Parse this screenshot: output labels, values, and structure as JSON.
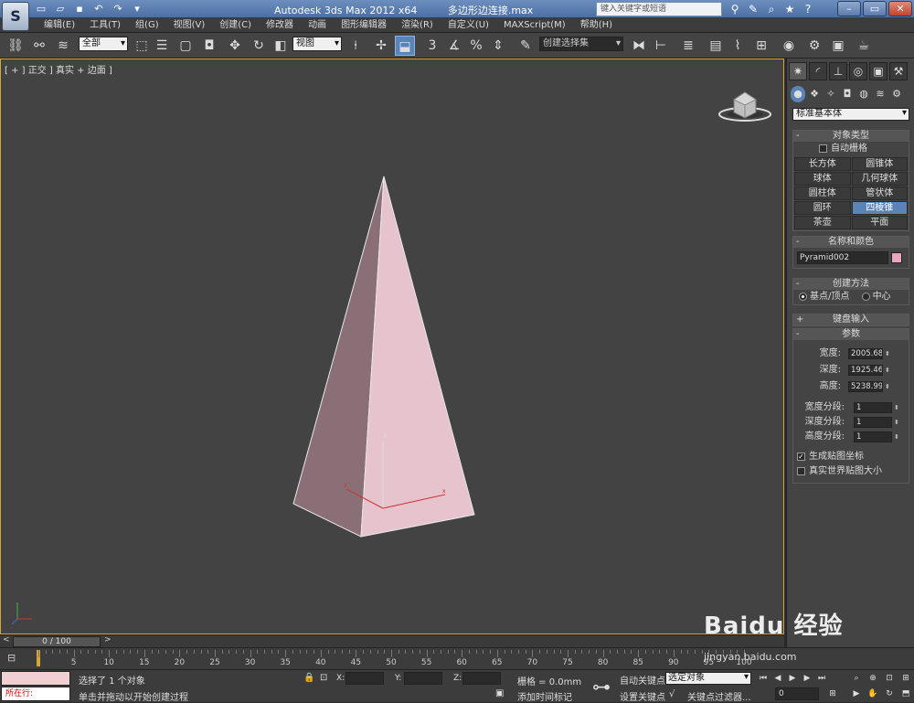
{
  "app": {
    "title": "Autodesk 3ds Max  2012 x64",
    "filename": "多边形边连接.max",
    "logo": "S",
    "search_placeholder": "键入关键字或短语"
  },
  "menu": [
    "编辑(E)",
    "工具(T)",
    "组(G)",
    "视图(V)",
    "创建(C)",
    "修改器",
    "动画",
    "图形编辑器",
    "渲染(R)",
    "自定义(U)",
    "MAXScript(M)",
    "帮助(H)"
  ],
  "toolbar": {
    "selection_filter": "全部",
    "ref_coord": "视图",
    "named_selection": "创建选择集"
  },
  "viewport": {
    "label": "[ + ] 正交 ] 真实 + 边面 ]"
  },
  "command_panel": {
    "category": "标准基本体",
    "object_type": {
      "title": "对象类型",
      "autogrid_label": "自动栅格",
      "buttons": [
        "长方体",
        "圆锥体",
        "球体",
        "几何球体",
        "圆柱体",
        "管状体",
        "圆环",
        "四棱锥",
        "茶壶",
        "平面"
      ],
      "active": "四棱锥"
    },
    "name_color": {
      "title": "名称和颜色",
      "name": "Pyramid002",
      "color": "#e8a6c0"
    },
    "creation_method": {
      "title": "创建方法",
      "options": [
        "基点/顶点",
        "中心"
      ],
      "selected": "基点/顶点"
    },
    "keyboard_entry": {
      "title": "键盘输入"
    },
    "parameters": {
      "title": "参数",
      "width_label": "宽度:",
      "width": "2005.685",
      "depth_label": "深度:",
      "depth": "1925.464",
      "height_label": "高度:",
      "height": "5238.991",
      "wseg_label": "宽度分段:",
      "wseg": "1",
      "dseg_label": "深度分段:",
      "dseg": "1",
      "hseg_label": "高度分段:",
      "hseg": "1",
      "gen_mapping": "生成贴图坐标",
      "real_world": "真实世界贴图大小"
    }
  },
  "timeline": {
    "slider": "0 / 100",
    "ticks": [
      "5",
      "10",
      "15",
      "20",
      "25",
      "30",
      "35",
      "40",
      "45",
      "50",
      "55",
      "60",
      "65",
      "70",
      "75",
      "80",
      "85",
      "90",
      "95",
      "100"
    ]
  },
  "status": {
    "listener": "所在行:",
    "selected_msg": "选择了 1 个对象",
    "prompt_msg": "单击并拖动以开始创建过程",
    "x_label": "X:",
    "y_label": "Y:",
    "z_label": "Z:",
    "grid": "栅格 = 0.0mm",
    "add_tag": "添加时间标记",
    "auto_key": "自动关键点",
    "set_key": "设置关键点",
    "key_mode": "选定对象",
    "key_filters": "关键点过滤器...",
    "frame": "0"
  },
  "watermark": {
    "main": "Baidu 经验",
    "sub": "jingyan.baidu.com"
  }
}
